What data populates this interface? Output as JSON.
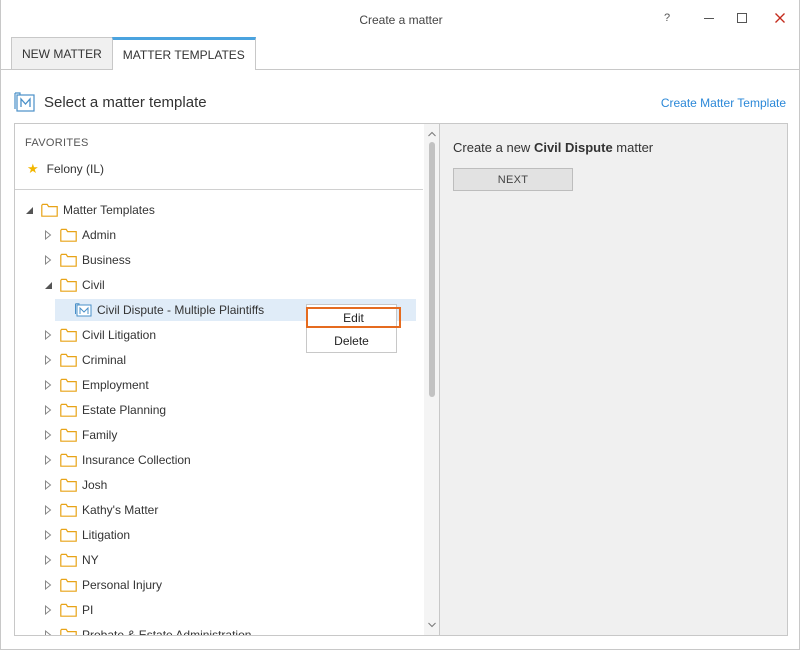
{
  "window": {
    "title": "Create a matter",
    "help_label": "?"
  },
  "tabs": [
    {
      "label": "NEW MATTER",
      "active": false
    },
    {
      "label": "MATTER TEMPLATES",
      "active": true
    }
  ],
  "header": {
    "title": "Select a matter template",
    "create_link": "Create Matter Template"
  },
  "favorites": {
    "label": "FAVORITES",
    "items": [
      {
        "label": "Felony (IL)",
        "icon": "star-icon"
      }
    ]
  },
  "tree": {
    "root_label": "Matter Templates",
    "items": [
      {
        "label": "Admin",
        "expanded": false
      },
      {
        "label": "Business",
        "expanded": false
      },
      {
        "label": "Civil",
        "expanded": true
      },
      {
        "label": "Civil Dispute - Multiple Plaintiffs",
        "child": true,
        "selected": true
      },
      {
        "label": "Civil Litigation",
        "expanded": false
      },
      {
        "label": "Criminal",
        "expanded": false
      },
      {
        "label": "Employment",
        "expanded": false
      },
      {
        "label": "Estate Planning",
        "expanded": false
      },
      {
        "label": "Family",
        "expanded": false
      },
      {
        "label": "Insurance Collection",
        "expanded": false
      },
      {
        "label": "Josh",
        "expanded": false
      },
      {
        "label": "Kathy's Matter",
        "expanded": false
      },
      {
        "label": "Litigation",
        "expanded": false
      },
      {
        "label": "NY",
        "expanded": false
      },
      {
        "label": "Personal Injury",
        "expanded": false
      },
      {
        "label": "PI",
        "expanded": false
      },
      {
        "label": "Probate & Estate Administration",
        "expanded": false
      }
    ]
  },
  "context_menu": {
    "edit_label": "Edit",
    "delete_label": "Delete"
  },
  "right_pane": {
    "text_prefix": "Create a new ",
    "text_bold": "Civil Dispute",
    "text_suffix": " matter",
    "next_label": "NEXT"
  },
  "colors": {
    "accent": "#2b88d8",
    "tab_highlight": "#4aa3df",
    "folder": "#e8a317",
    "highlight_border": "#e56b1f",
    "star": "#f2b600"
  }
}
